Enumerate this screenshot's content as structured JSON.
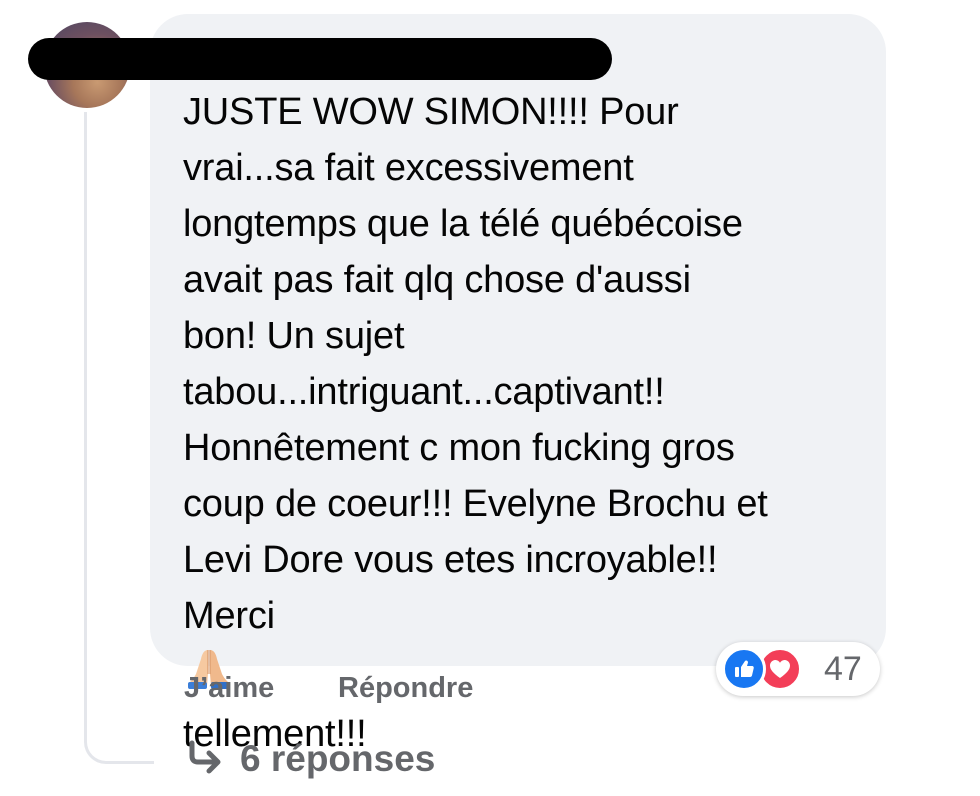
{
  "comment": {
    "author_redacted": true,
    "text_lines": [
      "JUSTE WOW SIMON!!!! Pour",
      "vrai...sa fait excessivement",
      "longtemps que la télé québécoise",
      "avait pas fait qlq chose d'aussi",
      "bon! Un sujet",
      "tabou...intriguant...captivant!!",
      "Honnêtement c mon fucking gros",
      "coup de coeur!!! Evelyne Brochu et",
      "Levi Dore vous etes incroyable!!"
    ],
    "last_line": {
      "before": "Merci",
      "emoji": "folded-hands-icon",
      "after": "tellement!!!"
    }
  },
  "reactions": {
    "icons": [
      "like-icon",
      "love-icon"
    ],
    "count": "47",
    "colors": {
      "like": "#1877f2",
      "love": "#f33e58"
    }
  },
  "actions": {
    "like_label": "J’aime",
    "reply_label": "Répondre"
  },
  "replies": {
    "icon": "reply-arrow-icon",
    "label": "6 réponses"
  },
  "colors": {
    "bubble": "#f0f2f5",
    "text": "#050505",
    "secondary": "#65676b",
    "thread_line": "#e4e6eb"
  }
}
